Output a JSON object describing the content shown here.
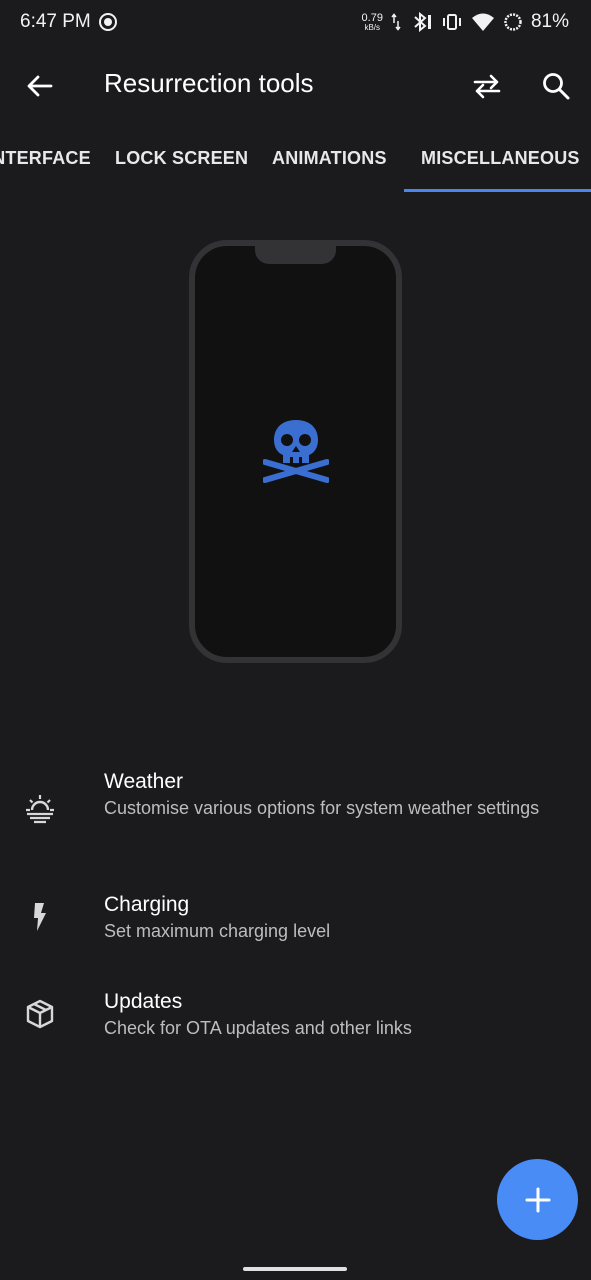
{
  "status_bar": {
    "time": "6:47 PM",
    "net_speed_value": "0.79",
    "net_speed_unit": "kB/s",
    "battery": "81%"
  },
  "app_bar": {
    "title": "Resurrection tools",
    "icons": [
      "back-arrow-icon",
      "swap-icon",
      "search-icon"
    ]
  },
  "tabs": [
    {
      "label": "INTERFACE",
      "selected": false
    },
    {
      "label": "LOCK SCREEN",
      "selected": false
    },
    {
      "label": "ANIMATIONS",
      "selected": false
    },
    {
      "label": "MISCELLANEOUS",
      "selected": true
    }
  ],
  "list": [
    {
      "title": "Weather",
      "subtitle": "Customise various options for system weather settings",
      "icon": "weather-icon"
    },
    {
      "title": "Charging",
      "subtitle": "Set maximum charging level",
      "icon": "flash-icon"
    },
    {
      "title": "Updates",
      "subtitle": "Check for OTA updates and other links",
      "icon": "package-icon"
    }
  ],
  "fab": {
    "icon": "plus-icon"
  },
  "colors": {
    "background": "#1b1b1d",
    "accent": "#4a85f0",
    "fab": "#4a8cf5",
    "skull": "#3a6fd1"
  }
}
